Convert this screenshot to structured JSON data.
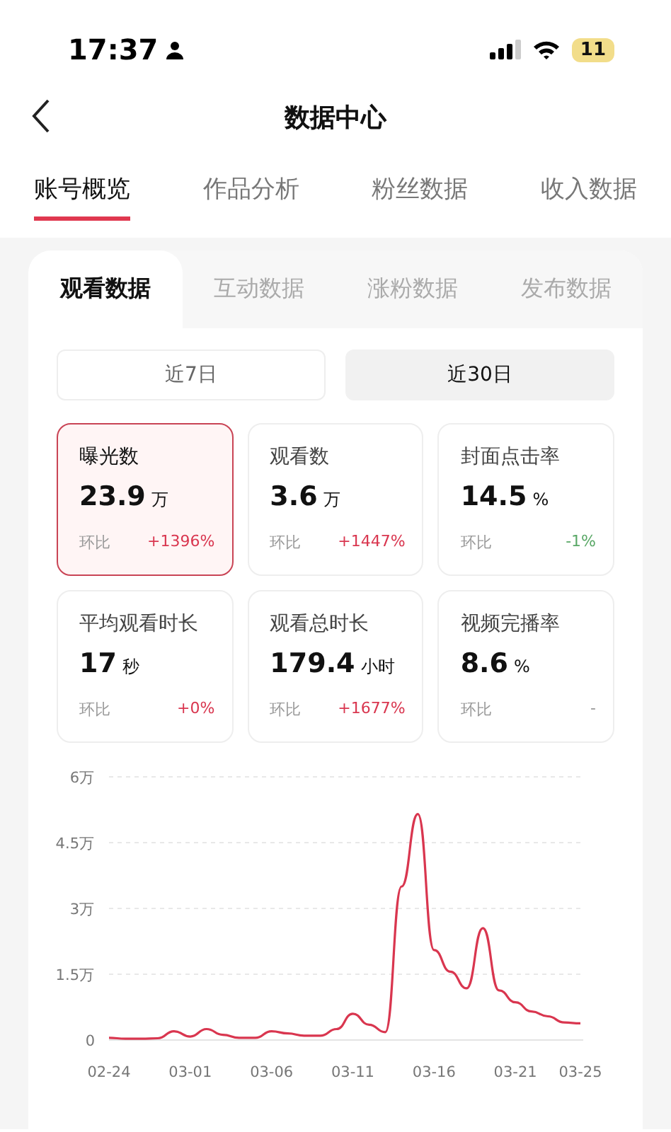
{
  "status_bar": {
    "time": "17:37",
    "battery": "11"
  },
  "header": {
    "title": "数据中心"
  },
  "main_tabs": [
    {
      "label": "账号概览",
      "selected": true
    },
    {
      "label": "作品分析",
      "selected": false
    },
    {
      "label": "粉丝数据",
      "selected": false
    },
    {
      "label": "收入数据",
      "selected": false
    }
  ],
  "sub_tabs": [
    {
      "label": "观看数据",
      "selected": true
    },
    {
      "label": "互动数据",
      "selected": false
    },
    {
      "label": "涨粉数据",
      "selected": false
    },
    {
      "label": "发布数据",
      "selected": false
    }
  ],
  "ranges": [
    {
      "label": "近7日",
      "selected": false
    },
    {
      "label": "近30日",
      "selected": true
    }
  ],
  "metrics": [
    {
      "label": "曝光数",
      "value": "23.9",
      "unit": "万",
      "compare_label": "环比",
      "change": "+1396%",
      "color": "#d9364f",
      "selected": true
    },
    {
      "label": "观看数",
      "value": "3.6",
      "unit": "万",
      "compare_label": "环比",
      "change": "+1447%",
      "color": "#d9364f",
      "selected": false
    },
    {
      "label": "封面点击率",
      "value": "14.5",
      "unit": "%",
      "compare_label": "环比",
      "change": "-1%",
      "color": "#5aa867",
      "selected": false
    },
    {
      "label": "平均观看时长",
      "value": "17",
      "unit": "秒",
      "compare_label": "环比",
      "change": "+0%",
      "color": "#d9364f",
      "selected": false
    },
    {
      "label": "观看总时长",
      "value": "179.4",
      "unit": "小时",
      "compare_label": "环比",
      "change": "+1677%",
      "color": "#d9364f",
      "selected": false
    },
    {
      "label": "视频完播率",
      "value": "8.6",
      "unit": "%",
      "compare_label": "环比",
      "change": "-",
      "color": "#999999",
      "selected": false
    }
  ],
  "chart": {
    "chart_data": {
      "type": "line",
      "categories": [
        "02-24",
        null,
        null,
        null,
        null,
        "03-01",
        null,
        null,
        null,
        null,
        "03-06",
        null,
        null,
        null,
        null,
        "03-11",
        null,
        null,
        null,
        null,
        "03-16",
        null,
        null,
        null,
        null,
        "03-21",
        null,
        null,
        null,
        "03-25"
      ],
      "grid": true,
      "series": [
        {
          "color": "#d9364f",
          "values": [
            0.05,
            0.03,
            0.03,
            0.04,
            0.2,
            0.08,
            0.25,
            0.12,
            0.05,
            0.05,
            0.2,
            0.15,
            0.1,
            0.1,
            0.25,
            0.6,
            0.35,
            0.18,
            3.5,
            5.15,
            2.05,
            1.56,
            1.18,
            2.55,
            1.13,
            0.86,
            0.65,
            0.54,
            0.4,
            0.38
          ]
        }
      ],
      "ylim": [
        0,
        6
      ],
      "yticks": [
        {
          "value": 0,
          "label": "0"
        },
        {
          "value": 1.5,
          "label": "1.5万"
        },
        {
          "value": 3,
          "label": "3万"
        },
        {
          "value": 4.5,
          "label": "4.5万"
        },
        {
          "value": 6,
          "label": "6万"
        }
      ]
    }
  }
}
